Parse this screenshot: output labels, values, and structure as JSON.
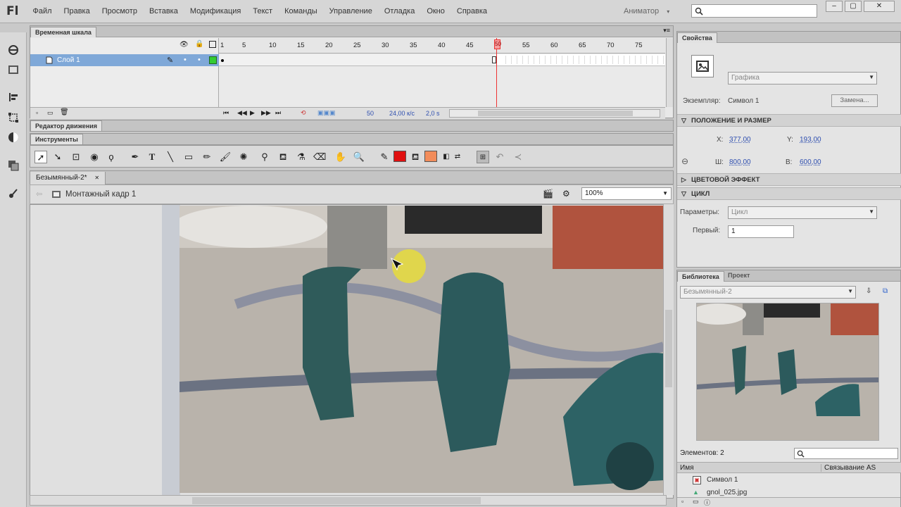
{
  "app": {
    "logo": "Fl"
  },
  "menu": [
    "Файл",
    "Правка",
    "Просмотр",
    "Вставка",
    "Модификация",
    "Текст",
    "Команды",
    "Управление",
    "Отладка",
    "Окно",
    "Справка"
  ],
  "workspace": {
    "label": "Аниматор",
    "arrow": "▾"
  },
  "window_controls": {
    "minimize": "–",
    "restore": "▢",
    "close": "✕"
  },
  "timeline": {
    "tab": "Временная шкала",
    "layer_name": "Слой 1",
    "ruler_ticks": [
      "1",
      "5",
      "10",
      "15",
      "20",
      "25",
      "30",
      "35",
      "40",
      "45",
      "50",
      "55",
      "60",
      "65",
      "70",
      "75"
    ],
    "current_frame": "50",
    "status_frame": "50",
    "fps": "24,00 к/с",
    "time": "2,0 s"
  },
  "motion_editor": {
    "tab": "Редактор движения"
  },
  "tools": {
    "tab": "Инструменты",
    "stroke_color": "#e01010",
    "fill_color": "#f28c5a"
  },
  "document": {
    "tab": "Безымянный-2*",
    "close": "✕",
    "scene": "Монтажный кадр 1",
    "zoom": "100%"
  },
  "properties": {
    "tab": "Свойства",
    "type_select": "Графика",
    "instance_label": "Экземпляр:",
    "instance_value": "Символ 1",
    "swap_button": "Замена...",
    "position_section": "ПОЛОЖЕНИЕ И РАЗМЕР",
    "x_label": "X:",
    "x_value": "377,00",
    "y_label": "Y:",
    "y_value": "193,00",
    "w_label": "Ш:",
    "w_value": "800,00",
    "h_label": "В:",
    "h_value": "600,00",
    "color_section": "ЦВЕТОВОЙ ЭФФЕКТ",
    "loop_section": "ЦИКЛ",
    "options_label": "Параметры:",
    "options_value": "Цикл",
    "first_label": "Первый:",
    "first_value": "1"
  },
  "library": {
    "tab": "Библиотека",
    "tab2": "Проект",
    "doc_select": "Безымянный-2",
    "count": "Элементов: 2",
    "col_name": "Имя",
    "col_linkage": "Связывание AS",
    "items": [
      "Символ 1",
      "gnol_025.jpg"
    ]
  }
}
